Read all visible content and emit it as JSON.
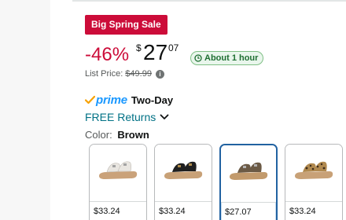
{
  "deal": {
    "badge": "Big Spring Sale"
  },
  "price": {
    "discount": "-46%",
    "symbol": "$",
    "whole": "27",
    "fraction": "07"
  },
  "delivery_timer": {
    "label": "About 1 hour",
    "icon": "clock-icon"
  },
  "list_price": {
    "label": "List Price:",
    "value": "$49.99",
    "icon": "info-icon"
  },
  "prime": {
    "brand": "prime",
    "label": "Two-Day",
    "icon": "prime-check-icon"
  },
  "returns": {
    "label": "FREE Returns",
    "icon": "chevron-down-icon"
  },
  "color": {
    "label": "Color:",
    "value": "Brown"
  },
  "swatches": [
    {
      "name": "White",
      "price": "$33.24",
      "selected": false,
      "upper_color": "#e9e6e1",
      "sole_color": "#caa27a"
    },
    {
      "name": "Black",
      "price": "$33.24",
      "selected": false,
      "upper_color": "#1f1f1f",
      "sole_color": "#c8a177"
    },
    {
      "name": "Brown",
      "price": "$27.07",
      "selected": true,
      "upper_color": "#6b5a45",
      "sole_color": "#c29a6c"
    },
    {
      "name": "Leopard",
      "price": "$33.24",
      "selected": false,
      "upper_color": "#b0894f",
      "sole_color": "#c8a177"
    }
  ],
  "colors": {
    "deal_red": "#cc0c39",
    "link_teal": "#007185",
    "prime_blue": "#1a98ff",
    "prime_orange": "#f7a200",
    "selected_border": "#2162a1"
  }
}
